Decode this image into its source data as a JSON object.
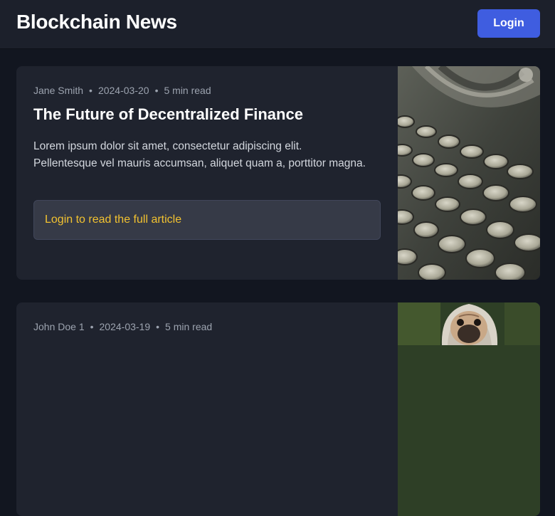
{
  "header": {
    "title": "Blockchain News",
    "login_label": "Login"
  },
  "articles": [
    {
      "author": "Jane Smith",
      "date": "2024-03-20",
      "read_time": "5 min read",
      "separator": "•",
      "title": "The Future of Decentralized Finance",
      "excerpt": "Lorem ipsum dolor sit amet, consectetur adipiscing elit. Pellentesque vel mauris accumsan, aliquet quam a, porttitor magna.",
      "gate_text": "Login to read the full article",
      "image": "typewriter-photo"
    },
    {
      "author": "John Doe 1",
      "date": "2024-03-19",
      "read_time": "5 min read",
      "separator": "•",
      "image": "pug-photo"
    }
  ],
  "colors": {
    "accent": "#3f5de0",
    "gate_link": "#f2c230",
    "card_bg": "#1f232e",
    "page_bg": "#121620"
  }
}
